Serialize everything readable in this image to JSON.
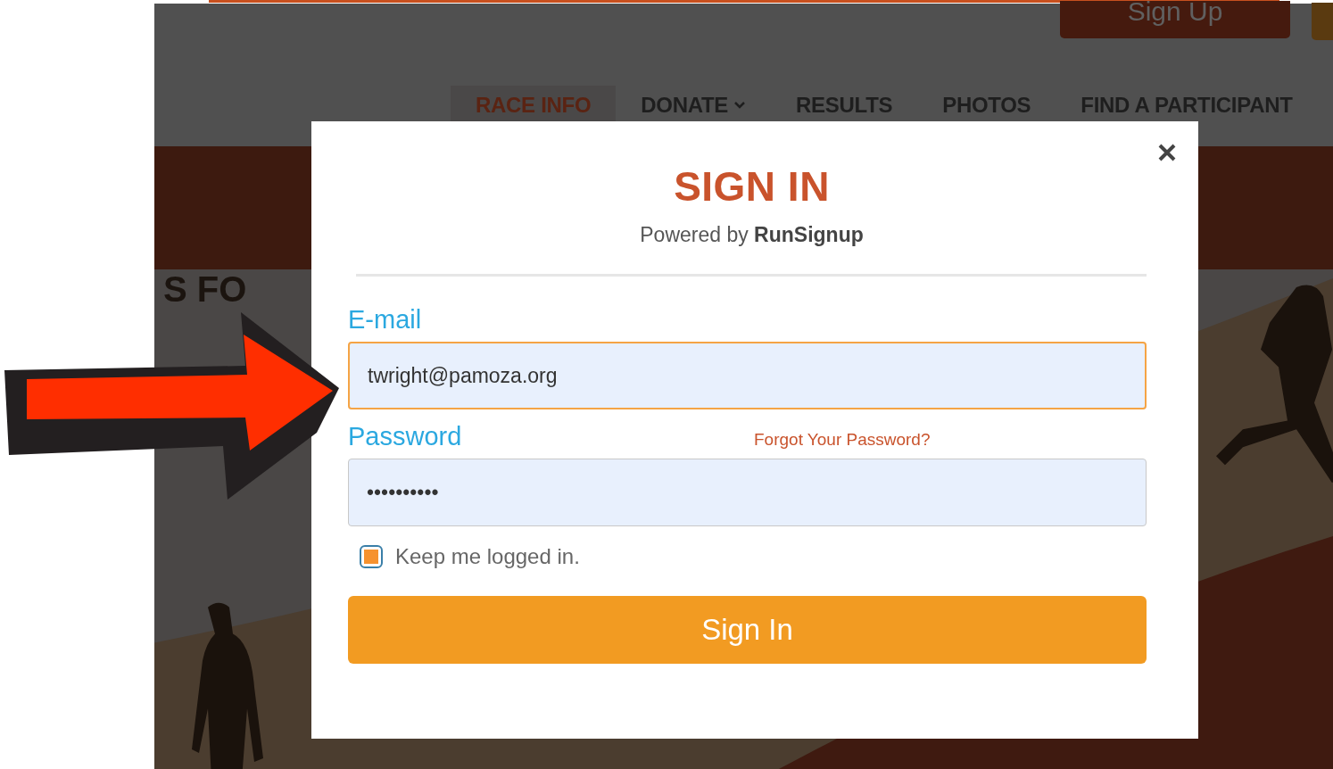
{
  "header": {
    "signup_button": "Sign Up"
  },
  "nav": [
    {
      "label": "RACE INFO",
      "selected": true,
      "kind": "link"
    },
    {
      "label": "DONATE",
      "selected": false,
      "kind": "dropdown"
    },
    {
      "label": "RESULTS",
      "selected": false,
      "kind": "link"
    },
    {
      "label": "PHOTOS",
      "selected": false,
      "kind": "link"
    },
    {
      "label": "FIND A PARTICIPANT",
      "selected": false,
      "kind": "link"
    }
  ],
  "hero": {
    "title_fragment": "S FO"
  },
  "modal": {
    "title": "SIGN IN",
    "subtitle": "Powered by **RunSignup**",
    "email": {
      "label": "E-mail",
      "value": "twright@pamoza.org",
      "focused": true
    },
    "password": {
      "label": "Password",
      "value": "••••••••••",
      "forgot_link": "Forgot Your Password?"
    },
    "keep_logged_in": {
      "label": "Keep me logged in.",
      "checked": true
    },
    "submit": "Sign In"
  }
}
